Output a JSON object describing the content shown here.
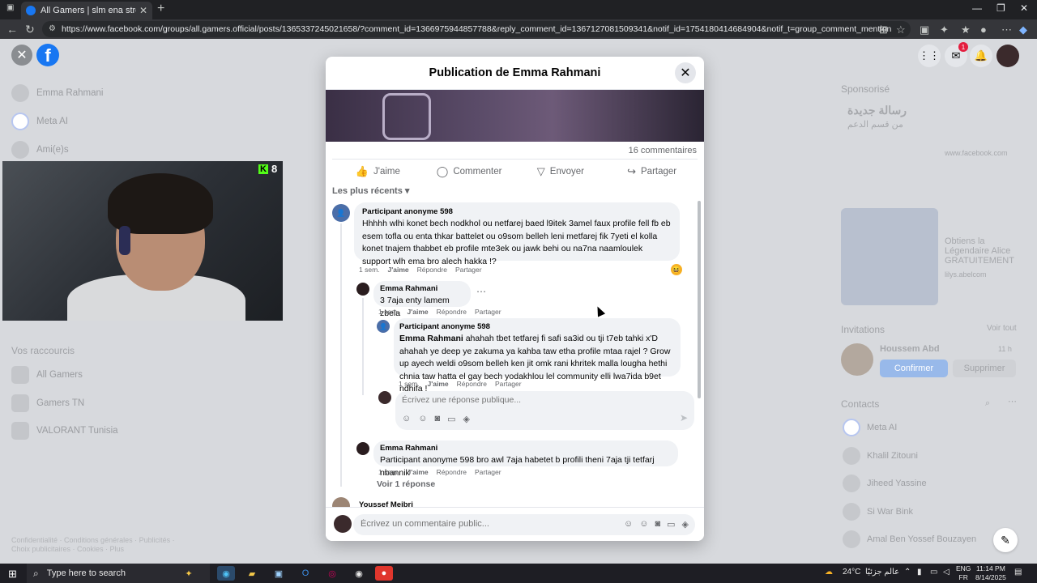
{
  "browser": {
    "tab_title": "All Gamers | slm ena streamer jdid",
    "url": "https://www.facebook.com/groups/all.gamers.official/posts/1365337245021658/?comment_id=1366975944857788&reply_comment_id=1367127081509341&notif_id=1754180414684904&notif_t=group_comment_mention"
  },
  "fb_left": {
    "items": [
      "Emma Rahmani",
      "Meta AI",
      "Ami(e)s"
    ],
    "shortcuts_header": "Vos raccourcis",
    "shortcuts": [
      "All Gamers",
      "Gamers TN",
      "VALORANT Tunisia"
    ],
    "footer_line1": "Confidentialité · Conditions générales · Publicités ·",
    "footer_line2": "Choix publicitaires · Cookies · Plus"
  },
  "fb_right": {
    "sponsored": "Sponsorisé",
    "ad_arabic_title": "رسالة جديدة",
    "ad_arabic_sub": "من قسم الدعم",
    "ad_site": "www.facebook.com",
    "ad2_title": "Obtiens la Légendaire Alice GRATUITEMENT",
    "ad2_site": "lilys.abelcom",
    "invitations": "Invitations",
    "see_all": "Voir tout",
    "inviter_name": "Houssem Abd",
    "inviter_time": "11 h",
    "confirm": "Confirmer",
    "delete": "Supprimer",
    "contacts_header": "Contacts",
    "contacts": [
      "Meta AI",
      "Khalil Zitouni",
      "Jiheed Yassine",
      "Si War Bink",
      "Amal Ben Yossef Bouzayen"
    ],
    "notif_count": "1"
  },
  "stream": {
    "kick_viewers": "8"
  },
  "modal": {
    "title": "Publication de Emma Rahmani",
    "comments_count": "16 commentaires",
    "actions": [
      "J'aime",
      "Commenter",
      "Envoyer",
      "Partager"
    ],
    "sort": "Les plus récents",
    "comments": [
      {
        "name": "Participant anonyme 598",
        "text": "Hhhhh wlhi konet bech nodkhol ou netfarej baed l9itek 3amel faux profile fell fb eb esem tofla ou enta thkar battelet ou o9som belleh leni metfarej fik 7yeti el kolla konet tnajem thabbet eb profile mte3ek ou jawk behi ou na7na naamloulek support wlh ema bro alech hakka !?",
        "time": "1 sem.",
        "like": "J'aime",
        "reply": "Répondre",
        "share": "Partager"
      },
      {
        "name": "Emma Rahmani",
        "text": "3 7aja enty lamem zbela",
        "time": "1 sem.",
        "like": "J'aime",
        "reply": "Répondre",
        "share": "Partager"
      },
      {
        "name": "Participant anonyme 598",
        "tag": "Emma Rahmani",
        "text": " ahahah tbet tetfarej fi safi sa3id ou tji t7eb tahki x'D ahahah ye deep ye zakuma ya kahba taw etha profile mtaa rajel ? Grow up ayech weldi o9som belleh ken jit omk rani khritek malla lougha hethi chnia taw hatta el gay bech yodakhlou lel community elli lwa7ida b9et ndhifa !",
        "time": "1 sem.",
        "like": "J'aime",
        "reply": "Répondre",
        "share": "Partager"
      },
      {
        "name": "Emma Rahmani",
        "text": "Participant anonyme 598 bro awl 7aja habetet b profili theni 7aja tji tetfarj nbannik",
        "time": "1 sem.",
        "like": "J'aime",
        "reply": "Répondre",
        "share": "Partager"
      }
    ],
    "reply_placeholder": "Écrivez une réponse publique...",
    "see_replies": "Voir 1 réponse",
    "next_commenter": "Youssef Meibri",
    "comment_placeholder": "Écrivez un commentaire public..."
  },
  "taskbar": {
    "search_placeholder": "Type here to search",
    "weather_temp": "24°C",
    "weather_text": "عالم جزئيًا",
    "lang_top": "ENG",
    "lang_bottom": "FR",
    "time": "11:14 PM",
    "date": "8/14/2025"
  }
}
